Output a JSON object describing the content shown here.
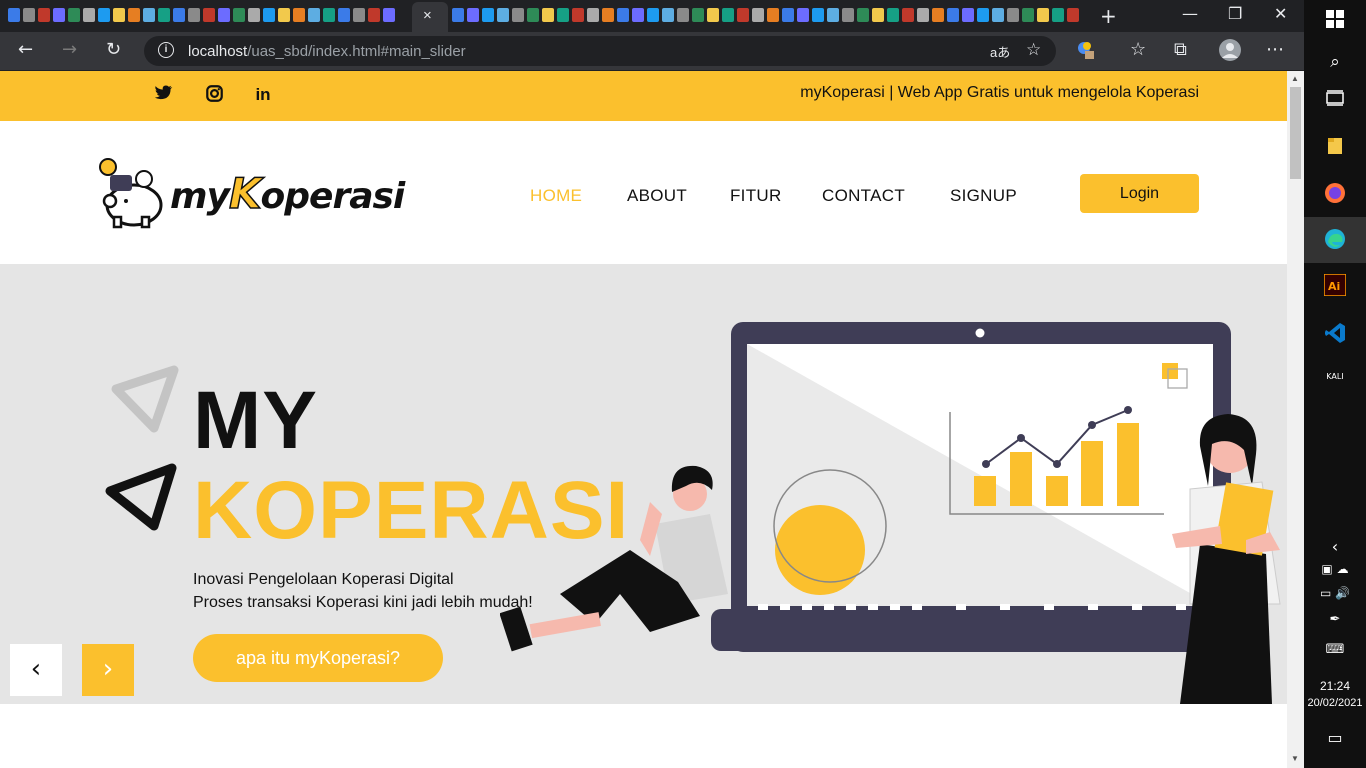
{
  "browser": {
    "active_tab_close": "×",
    "new_tab": "+",
    "url_host": "localhost",
    "url_path": "/uas_sbd/index.html#main_slider",
    "address_right_1": "aあ",
    "window_minimize": "—",
    "window_restore": "❐",
    "window_close": "✕",
    "toolbar_back": "←",
    "toolbar_forward": "→",
    "toolbar_reload": "↻",
    "toolbar_favorites": "☆",
    "toolbar_collections": "⧉",
    "toolbar_menu": "⋯"
  },
  "topbar": {
    "social": [
      "twitter-icon",
      "instagram-icon",
      "linkedin-icon"
    ],
    "twitter": "🐦",
    "instagram": "◎",
    "linkedin": "in",
    "tagline": "myKoperasi | Web App Gratis untuk mengelola Koperasi"
  },
  "header": {
    "logo_my": "my",
    "logo_k": "K",
    "logo_rest": "operasi",
    "nav": [
      "HOME",
      "ABOUT",
      "FITUR",
      "CONTACT",
      "SIGNUP"
    ],
    "active_nav": "HOME",
    "login_label": "Login"
  },
  "hero": {
    "title_line1": "MY",
    "title_line2": "KOPERASI",
    "subtitle_line1": "Inovasi Pengelolaan Koperasi Digital",
    "subtitle_line2": "Proses transaksi Koperasi kini jadi lebih mudah!",
    "cta_label": "apa itu myKoperasi?",
    "prev_label": "‹",
    "next_label": "›"
  },
  "colors": {
    "accent": "#fbc02d",
    "dark": "#111111",
    "slider_bg": "#e5e5e5",
    "laptop": "#3f3d56"
  },
  "taskbar": {
    "time": "21:24",
    "date": "20/02/2021"
  }
}
